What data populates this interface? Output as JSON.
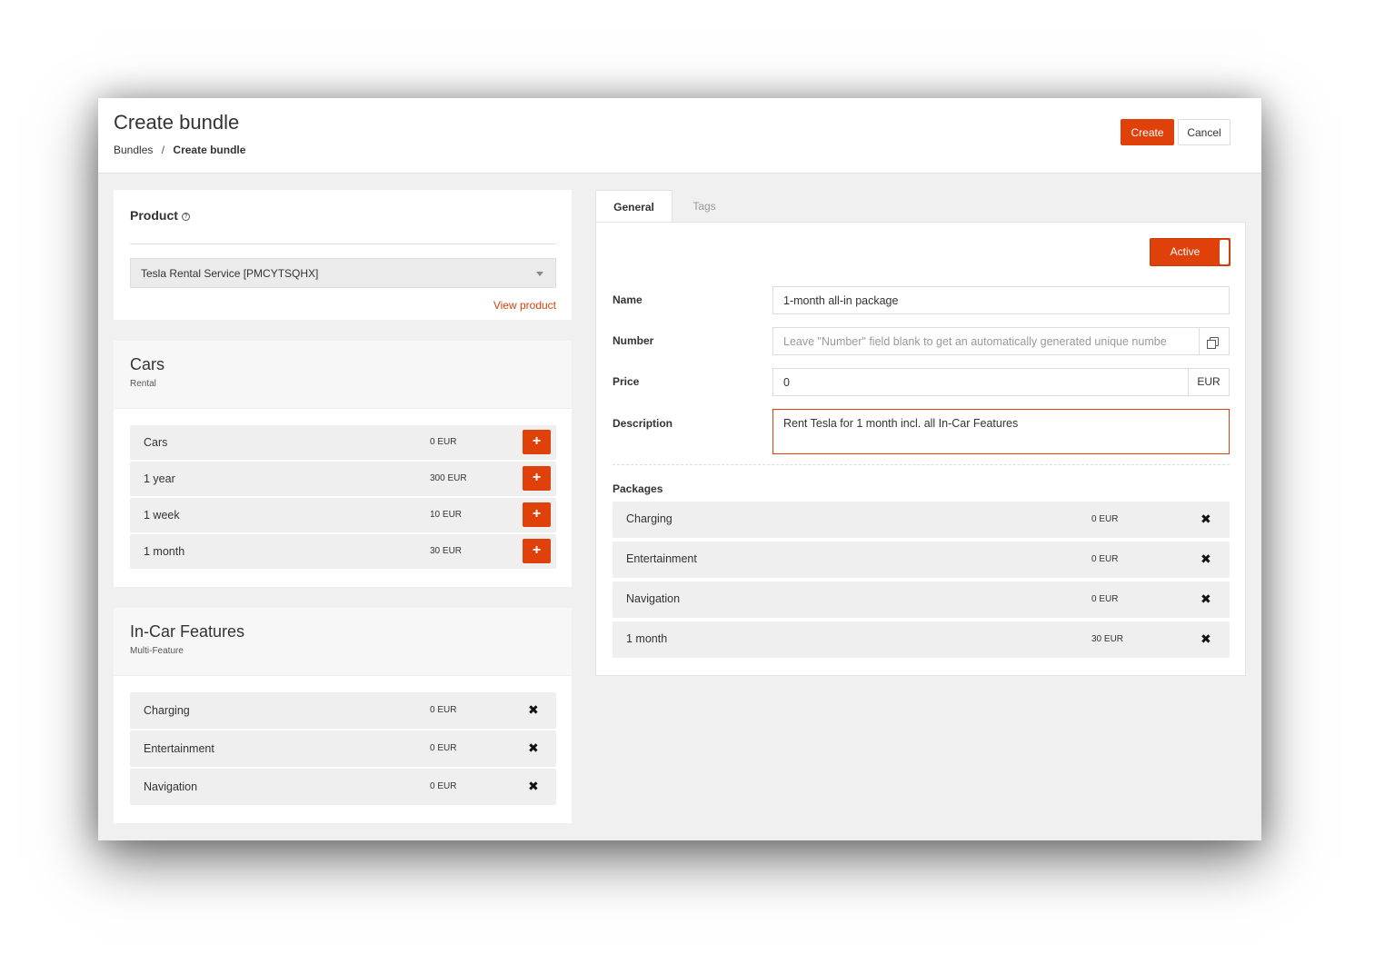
{
  "header": {
    "title": "Create bundle",
    "breadcrumb": {
      "root": "Bundles",
      "separator": "/",
      "current": "Create bundle"
    },
    "create_label": "Create",
    "cancel_label": "Cancel"
  },
  "product": {
    "title": "Product",
    "help_icon": "?",
    "selected": "Tesla Rental Service [PMCYTSQHX]",
    "view_link": "View product"
  },
  "groups": [
    {
      "title": "Cars",
      "subtitle": "Rental",
      "items": [
        {
          "label": "Cars",
          "price": "0 EUR",
          "action": "+"
        },
        {
          "label": "1 year",
          "price": "300 EUR",
          "action": "+"
        },
        {
          "label": "1 week",
          "price": "10 EUR",
          "action": "+"
        },
        {
          "label": "1 month",
          "price": "30 EUR",
          "action": "+"
        }
      ]
    },
    {
      "title": "In-Car Features",
      "subtitle": "Multi-Feature",
      "items": [
        {
          "label": "Charging",
          "price": "0 EUR",
          "action": "✖"
        },
        {
          "label": "Entertainment",
          "price": "0 EUR",
          "action": "✖"
        },
        {
          "label": "Navigation",
          "price": "0 EUR",
          "action": "✖"
        }
      ]
    }
  ],
  "tabs": [
    {
      "label": "General",
      "active": true
    },
    {
      "label": "Tags",
      "active": false
    }
  ],
  "form": {
    "status_label": "Active",
    "name_label": "Name",
    "name_value": "1-month all-in package",
    "number_label": "Number",
    "number_placeholder": "Leave \"Number\" field blank to get an automatically generated unique numbe",
    "price_label": "Price",
    "price_value": "0",
    "currency": "EUR",
    "description_label": "Description",
    "description_value": "Rent Tesla for 1 month incl. all In-Car Features",
    "packages_label": "Packages"
  },
  "packages": [
    {
      "label": "Charging",
      "price": "0 EUR",
      "action": "✖"
    },
    {
      "label": "Entertainment",
      "price": "0 EUR",
      "action": "✖"
    },
    {
      "label": "Navigation",
      "price": "0 EUR",
      "action": "✖"
    },
    {
      "label": "1 month",
      "price": "30 EUR",
      "action": "✖"
    }
  ],
  "colors": {
    "accent": "#e0400a",
    "link": "#d8400c",
    "row_bg": "#efefef",
    "page_bg": "#f0f0f0"
  },
  "icons": {
    "help": "help-icon",
    "copy": "copy-icon",
    "add": "plus-icon",
    "remove": "close-icon",
    "dropdown": "caret-down-icon"
  }
}
